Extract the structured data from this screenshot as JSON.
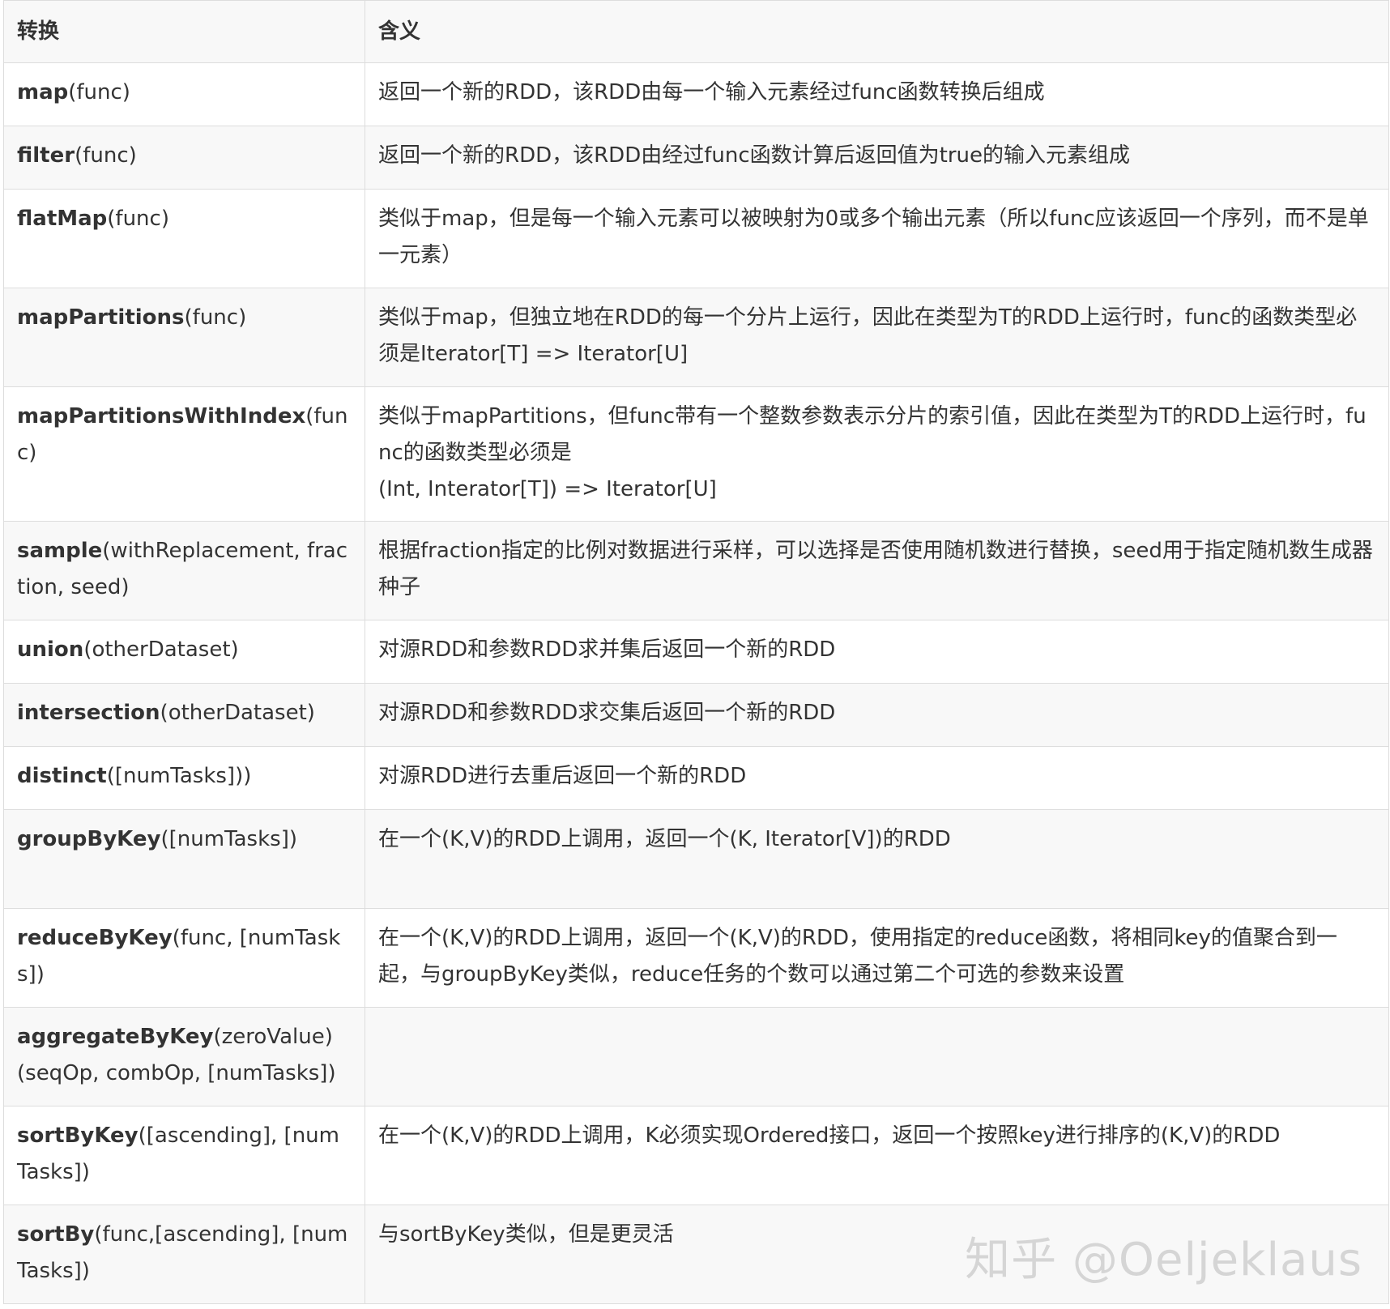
{
  "table": {
    "headers": [
      "转换",
      "含义"
    ],
    "rows": [
      {
        "name": "map",
        "args": "(func)",
        "desc": "返回一个新的RDD，该RDD由每一个输入元素经过func函数转换后组成"
      },
      {
        "name": "filter",
        "args": "(func)",
        "desc": "返回一个新的RDD，该RDD由经过func函数计算后返回值为true的输入元素组成"
      },
      {
        "name": "flatMap",
        "args": "(func)",
        "desc": "类似于map，但是每一个输入元素可以被映射为0或多个输出元素（所以func应该返回一个序列，而不是单一元素）"
      },
      {
        "name": "mapPartitions",
        "args": "(func)",
        "desc": "类似于map，但独立地在RDD的每一个分片上运行，因此在类型为T的RDD上运行时，func的函数类型必须是Iterator[T] => Iterator[U]"
      },
      {
        "name": "mapPartitionsWithIndex",
        "args": "(func)",
        "desc": "类似于mapPartitions，但func带有一个整数参数表示分片的索引值，因此在类型为T的RDD上运行时，func的函数类型必须是\n(Int, Interator[T]) => Iterator[U]"
      },
      {
        "name": "sample",
        "args": "(withReplacement, fraction, seed)",
        "desc": "根据fraction指定的比例对数据进行采样，可以选择是否使用随机数进行替换，seed用于指定随机数生成器种子"
      },
      {
        "name": "union",
        "args": "(otherDataset)",
        "desc": "对源RDD和参数RDD求并集后返回一个新的RDD"
      },
      {
        "name": "intersection",
        "args": "(otherDataset)",
        "desc": "对源RDD和参数RDD求交集后返回一个新的RDD"
      },
      {
        "name": "distinct",
        "args": "([numTasks]))",
        "desc": "对源RDD进行去重后返回一个新的RDD"
      },
      {
        "name": "groupByKey",
        "args": "([numTasks])",
        "desc": "在一个(K,V)的RDD上调用，返回一个(K, Iterator[V])的RDD"
      },
      {
        "name": "reduceByKey",
        "args": "(func, [numTasks])",
        "desc": "在一个(K,V)的RDD上调用，返回一个(K,V)的RDD，使用指定的reduce函数，将相同key的值聚合到一起，与groupByKey类似，reduce任务的个数可以通过第二个可选的参数来设置"
      },
      {
        "name": "aggregateByKey",
        "args": "(zeroValue)(seqOp, combOp, [numTasks])",
        "desc": ""
      },
      {
        "name": "sortByKey",
        "args": "([ascending], [numTasks])",
        "desc": "在一个(K,V)的RDD上调用，K必须实现Ordered接口，返回一个按照key进行排序的(K,V)的RDD"
      },
      {
        "name": "sortBy",
        "args": "(func,[ascending], [numTasks])",
        "desc": "与sortByKey类似，但是更灵活"
      }
    ]
  },
  "watermark": "知乎 @Oeljeklaus"
}
